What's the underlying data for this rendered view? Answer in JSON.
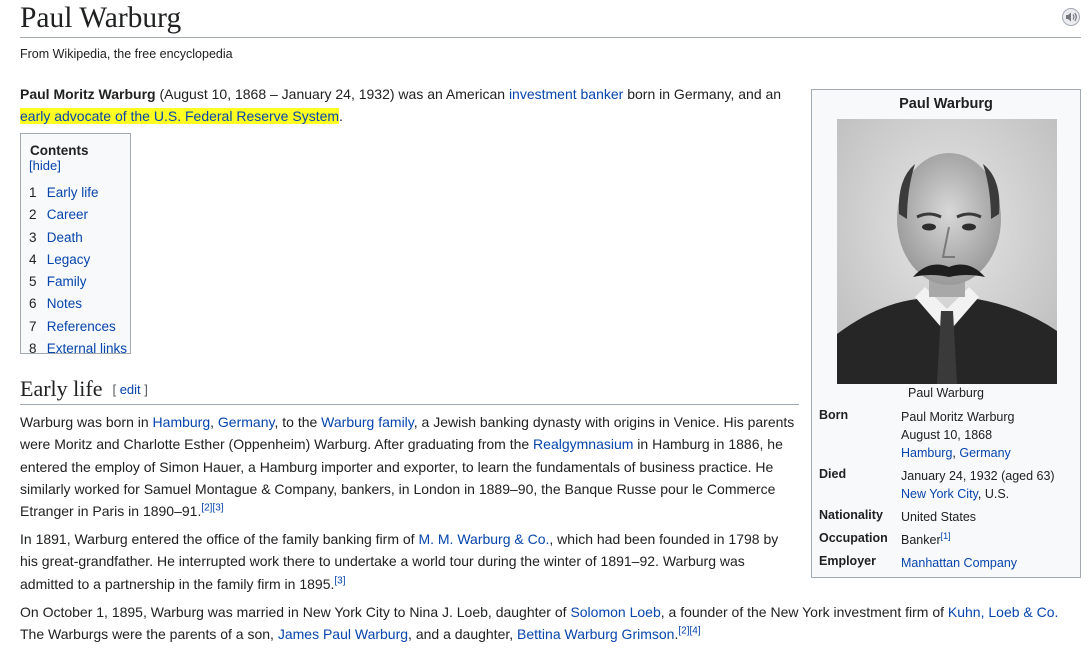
{
  "article": {
    "title": "Paul Warburg",
    "tagline": "From Wikipedia, the free encyclopedia"
  },
  "lead": {
    "bold_name": "Paul Moritz Warburg",
    "t1": " (August 10, 1868 – January 24, 1932) was an American ",
    "link_investment_banker": "investment banker",
    "t2": " born in Germany, and an ",
    "link_early_advocate": "early advocate of the U.S. Federal Reserve System",
    "t3": "."
  },
  "toc": {
    "title": "Contents",
    "hide": "[hide]",
    "items": [
      {
        "num": "1",
        "label": "Early life"
      },
      {
        "num": "2",
        "label": "Career"
      },
      {
        "num": "3",
        "label": "Death"
      },
      {
        "num": "4",
        "label": "Legacy"
      },
      {
        "num": "5",
        "label": "Family"
      },
      {
        "num": "6",
        "label": "Notes"
      },
      {
        "num": "7",
        "label": "References"
      },
      {
        "num": "8",
        "label": "External links"
      }
    ]
  },
  "section": {
    "heading": "Early life",
    "edit_open": "[ ",
    "edit": "edit",
    "edit_close": " ]"
  },
  "p1": {
    "a": "Warburg was born in ",
    "link_hamburg": "Hamburg",
    "b": ", ",
    "link_germany": "Germany",
    "c": ", to the ",
    "link_warburg_family": "Warburg family",
    "d": ", a Jewish banking dynasty with origins in Venice. His parents",
    "line2": "were Moritz and Charlotte Esther (Oppenheim) Warburg. After graduating from the ",
    "link_realgymnasium": "Realgymnasium",
    "e": " in Hamburg in 1886, he",
    "line3": "entered the employ of Simon Hauer, a Hamburg importer and exporter, to learn the fundamentals of business practice. He",
    "line4": "similarly worked for Samuel Montague & Company, bankers, in London in 1889–90, the Banque Russe pour le Commerce",
    "line5": "Etranger in Paris in 1890–91.",
    "ref1": "[2]",
    "ref2": "[3]"
  },
  "p2": {
    "a": "In 1891, Warburg entered the office of the family banking firm of ",
    "link_mm_warburg": "M. M. Warburg & Co.",
    "b": ", which had been founded in 1798 by",
    "line2": "his great-grandfather. He interrupted work there to undertake a world tour during the winter of 1891–92. Warburg was",
    "line3": "admitted to a partnership in the family firm in 1895.",
    "ref": "[3]"
  },
  "p3": {
    "a": "On October 1, 1895, Warburg was married in New York City to Nina J. Loeb, daughter of ",
    "link_solomon_loeb": "Solomon Loeb",
    "b": ", a founder of the New York investment firm of ",
    "link_kuhn": "Kuhn, Loeb & Co.",
    "line2a": "The Warburgs were the parents of a son, ",
    "link_james": "James Paul Warburg",
    "line2b": ", and a daughter, ",
    "link_bettina": "Bettina Warburg Grimson",
    "line2c": ".",
    "ref1": "[2]",
    "ref2": "[4]"
  },
  "infobox": {
    "title": "Paul Warburg",
    "caption": "Paul Warburg",
    "born_label": "Born",
    "born_name": "Paul Moritz Warburg",
    "born_date": "August 10, 1868",
    "born_place_hamburg": "Hamburg",
    "born_place_sep": ", ",
    "born_place_germany": "Germany",
    "died_label": "Died",
    "died_date": "January 24, 1932 (aged 63)",
    "died_place_nyc": "New York City",
    "died_place_rest": ", U.S.",
    "nationality_label": "Nationality",
    "nationality_value": "United States",
    "occupation_label": "Occupation",
    "occupation_value": "Banker",
    "occupation_ref": "[1]",
    "employer_label": "Employer",
    "employer_value": "Manhattan Company"
  },
  "colors": {
    "link": "#0645ad",
    "highlight": "#ffff22",
    "text": "#202122",
    "border": "#a2a9b1",
    "infobox_bg": "#f8f9fa"
  },
  "icons": {
    "audio": "speaker-audio-icon"
  }
}
